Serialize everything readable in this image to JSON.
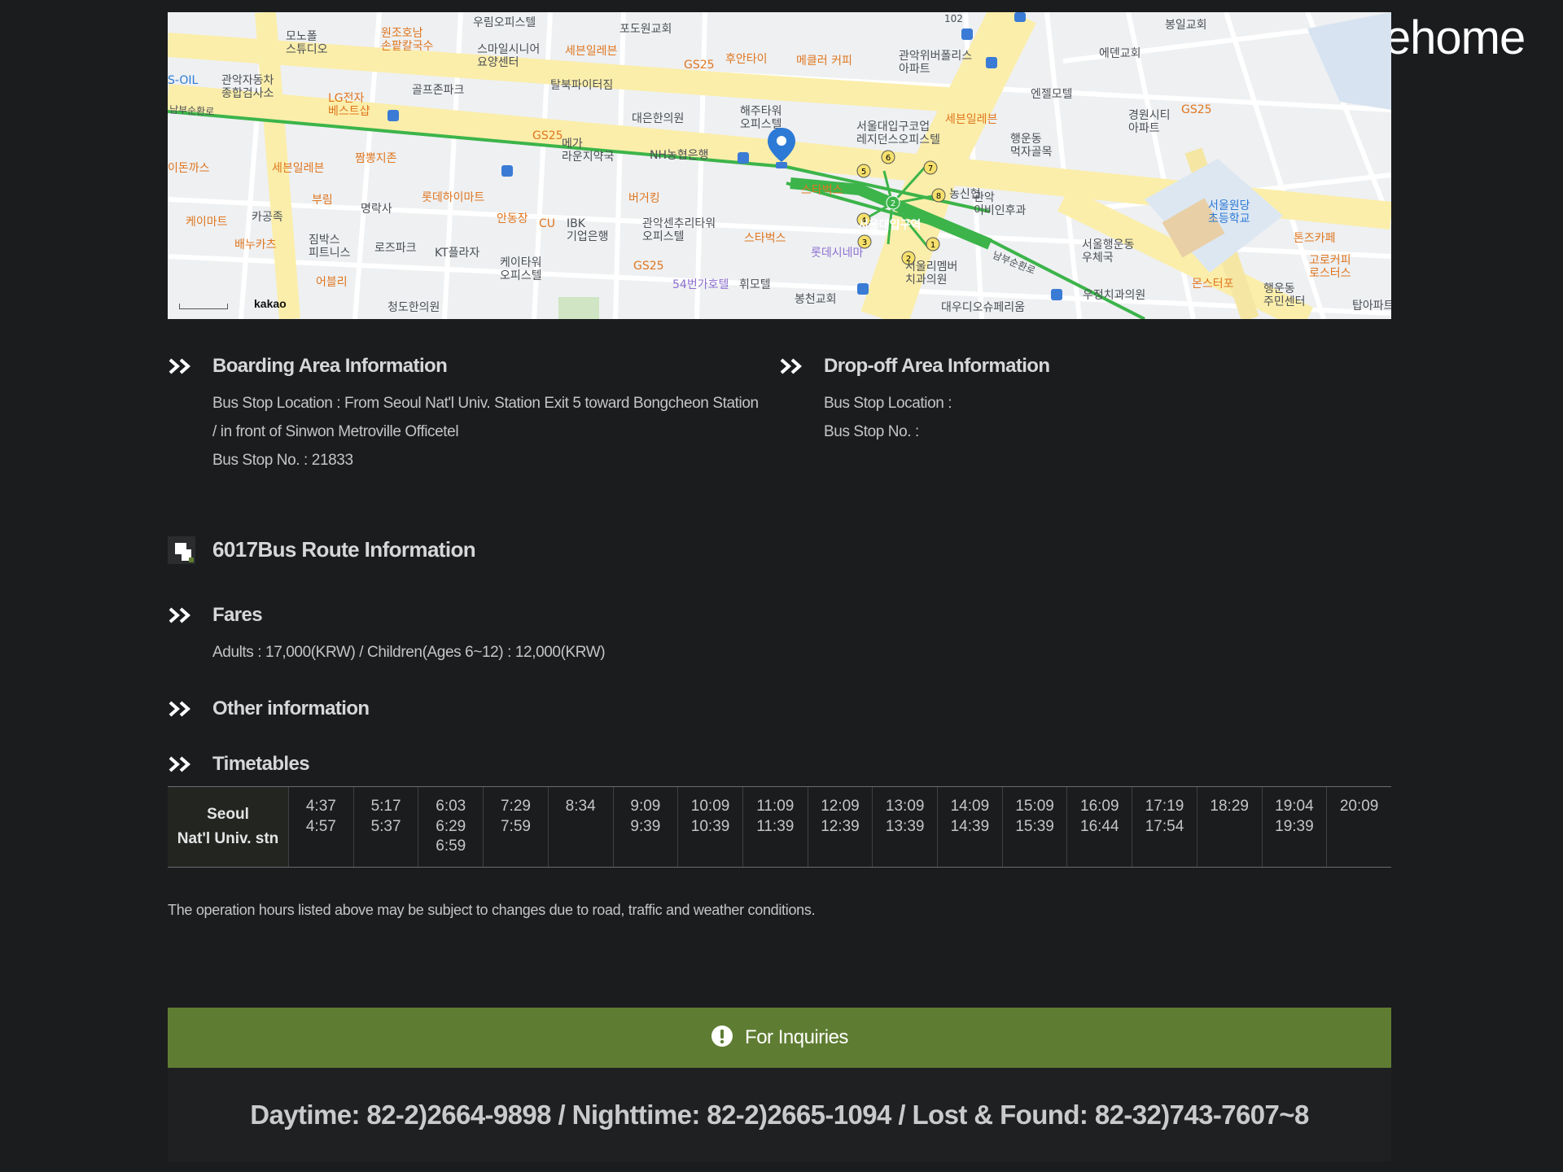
{
  "logo": {
    "text": "wehome"
  },
  "map": {
    "attribution": "kakao",
    "labels": [
      {
        "text": "모노폴\n스튜디오",
        "cls": ""
      },
      {
        "text": "원조호남\n손팥칼국수",
        "cls": "orange"
      },
      {
        "text": "우림오피스텔",
        "cls": ""
      },
      {
        "text": "포도원교회",
        "cls": ""
      },
      {
        "text": "스마일시니어\n요양센터",
        "cls": ""
      },
      {
        "text": "세븐일레븐",
        "cls": "orange"
      },
      {
        "text": "관악자동차\n종합검사소",
        "cls": ""
      },
      {
        "text": "S-OIL",
        "cls": "blue"
      },
      {
        "text": "골프존파크",
        "cls": ""
      },
      {
        "text": "LG전자\n베스트샵",
        "cls": "orange"
      },
      {
        "text": "탈북파이터짐",
        "cls": ""
      },
      {
        "text": "GS25",
        "cls": "orange"
      },
      {
        "text": "후안타이",
        "cls": "orange"
      },
      {
        "text": "메클러 커피",
        "cls": "orange"
      },
      {
        "text": "관악위버폴리스\n아파트",
        "cls": ""
      },
      {
        "text": "에덴교회",
        "cls": ""
      },
      {
        "text": "봉일교회",
        "cls": ""
      },
      {
        "text": "엔젤모텔",
        "cls": ""
      },
      {
        "text": "경원시티\n아파트",
        "cls": ""
      },
      {
        "text": "세븐일레븐",
        "cls": "orange"
      },
      {
        "text": "행운동\n먹자골목",
        "cls": ""
      },
      {
        "text": "해주타워\n오피스텔",
        "cls": ""
      },
      {
        "text": "서울대입구코업\n레지던스오피스텔",
        "cls": ""
      },
      {
        "text": "대은한의원",
        "cls": ""
      },
      {
        "text": "메가\n라운지약국",
        "cls": ""
      },
      {
        "text": "NH농협은행",
        "cls": ""
      },
      {
        "text": "GS25",
        "cls": "orange"
      },
      {
        "text": "짬뽕지존",
        "cls": "orange"
      },
      {
        "text": "세븐일레븐",
        "cls": "orange"
      },
      {
        "text": "이돈까스",
        "cls": "orange"
      },
      {
        "text": "부림",
        "cls": "orange"
      },
      {
        "text": "명락사",
        "cls": ""
      },
      {
        "text": "롯데하이마트",
        "cls": "orange"
      },
      {
        "text": "안동장",
        "cls": "orange"
      },
      {
        "text": "버거킹",
        "cls": "orange"
      },
      {
        "text": "스타벅스",
        "cls": "orange"
      },
      {
        "text": "농신협",
        "cls": ""
      },
      {
        "text": "관악\n이비인후과",
        "cls": ""
      },
      {
        "text": "케이마트",
        "cls": "orange"
      },
      {
        "text": "카공족",
        "cls": ""
      },
      {
        "text": "IBK\n기업은행",
        "cls": ""
      },
      {
        "text": "관악센추리타워\n오피스텔",
        "cls": ""
      },
      {
        "text": "스타벅스",
        "cls": "orange"
      },
      {
        "text": "서울대입구역",
        "cls": "green"
      },
      {
        "text": "서울원당\n초등학교",
        "cls": "blue"
      },
      {
        "text": "톤즈카페",
        "cls": "orange"
      },
      {
        "text": "짐박스\n피트니스",
        "cls": ""
      },
      {
        "text": "로즈파크",
        "cls": ""
      },
      {
        "text": "KT플라자",
        "cls": ""
      },
      {
        "text": "CU",
        "cls": "orange"
      },
      {
        "text": "케이타워\n오피스텔",
        "cls": ""
      },
      {
        "text": "배누카츠",
        "cls": "orange"
      },
      {
        "text": "롯데시네마",
        "cls": "purple"
      },
      {
        "text": "서울행운동\n우체국",
        "cls": ""
      },
      {
        "text": "고로커피\n로스터스",
        "cls": "orange"
      },
      {
        "text": "어블리",
        "cls": "orange"
      },
      {
        "text": "GS25",
        "cls": "orange"
      },
      {
        "text": "54번가호텔",
        "cls": "purple"
      },
      {
        "text": "휘모텔",
        "cls": ""
      },
      {
        "text": "서울리멤버\n치과의원",
        "cls": ""
      },
      {
        "text": "몬스터포",
        "cls": "orange"
      },
      {
        "text": "행운동\n주민센터",
        "cls": ""
      },
      {
        "text": "우정치과의원",
        "cls": ""
      },
      {
        "text": "봉천교회",
        "cls": ""
      },
      {
        "text": "청도한의원",
        "cls": ""
      },
      {
        "text": "대우디오슈페리움",
        "cls": ""
      },
      {
        "text": "탑아파트",
        "cls": ""
      },
      {
        "text": "남부순환로",
        "cls": ""
      },
      {
        "text": "남부순환로",
        "cls": ""
      },
      {
        "text": "GS25",
        "cls": "orange"
      },
      {
        "text": "102",
        "cls": ""
      }
    ]
  },
  "boarding": {
    "title": "Boarding Area Information",
    "line1": "Bus Stop Location : From Seoul Nat'l Univ. Station Exit 5 toward Bongcheon Station",
    "line2": "/ in front of Sinwon Metroville Officetel",
    "line3": "Bus Stop No. : 21833"
  },
  "dropoff": {
    "title": "Drop-off Area Information",
    "line1": "Bus Stop Location :",
    "line2": "Bus Stop No. :"
  },
  "route": {
    "title": "6017Bus Route Information"
  },
  "fares": {
    "title": "Fares",
    "text": "Adults : 17,000(KRW) / Children(Ages 6~12) : 12,000(KRW)"
  },
  "other": {
    "title": "Other information"
  },
  "timetables": {
    "title": "Timetables",
    "station_line1": "Seoul",
    "station_line2": "Nat'l Univ. stn",
    "columns": [
      [
        "4:37",
        "4:57"
      ],
      [
        "5:17",
        "5:37"
      ],
      [
        "6:03",
        "6:29",
        "6:59"
      ],
      [
        "7:29",
        "7:59"
      ],
      [
        "8:34"
      ],
      [
        "9:09",
        "9:39"
      ],
      [
        "10:09",
        "10:39"
      ],
      [
        "11:09",
        "11:39"
      ],
      [
        "12:09",
        "12:39"
      ],
      [
        "13:09",
        "13:39"
      ],
      [
        "14:09",
        "14:39"
      ],
      [
        "15:09",
        "15:39"
      ],
      [
        "16:09",
        "16:44"
      ],
      [
        "17:19",
        "17:54"
      ],
      [
        "18:29"
      ],
      [
        "19:04",
        "19:39"
      ],
      [
        "20:09"
      ]
    ]
  },
  "notice": "The operation hours listed above may be subject to changes due to road, traffic and weather conditions.",
  "inquiries": {
    "title": "For Inquiries",
    "contacts": "Daytime: 82-2)2664-9898 / Nighttime: 82-2)2665-1094 / Lost & Found: 82-32)743-7607~8"
  },
  "colors": {
    "background": "#1b1c1e",
    "accent_green": "#5f7d32",
    "subway_green": "#3cb44a",
    "map_road_yellow": "#fbeeaa"
  }
}
